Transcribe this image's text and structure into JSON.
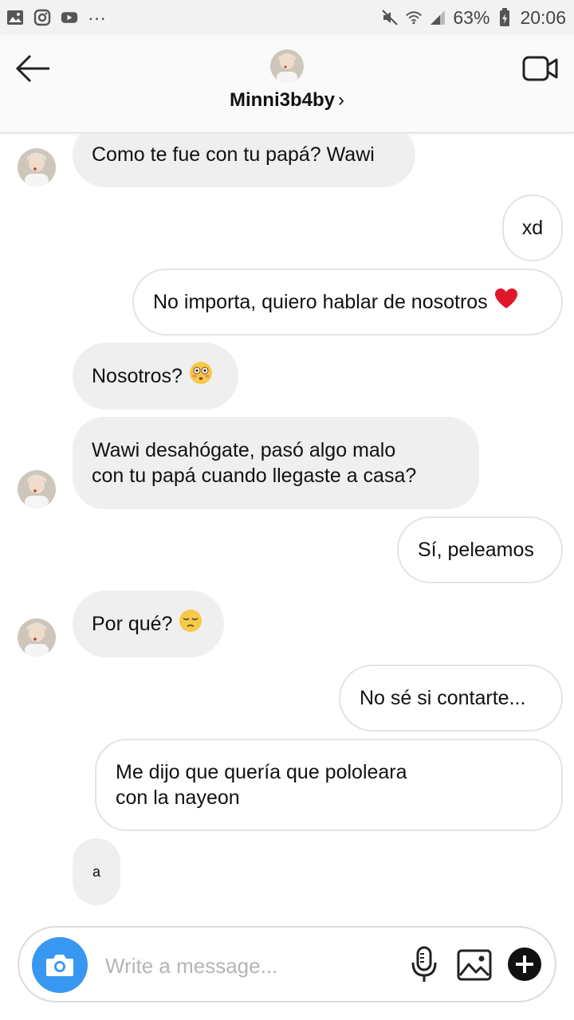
{
  "status_bar": {
    "battery": "63%",
    "time": "20:06",
    "dots": "···"
  },
  "header": {
    "username": "Minni3b4by",
    "chevron": "›"
  },
  "messages": [
    {
      "side": "in",
      "text": "Como te fue con tu papá? Wawi",
      "avatar": true
    },
    {
      "side": "out",
      "text": "xd"
    },
    {
      "side": "out",
      "text": "No importa, quiero hablar de nosotros",
      "emoji": "heart"
    },
    {
      "side": "in",
      "text": "Nosotros?",
      "emoji": "flushed-face"
    },
    {
      "side": "in",
      "line1": "Wawi desahógate, pasó algo malo",
      "line2": "con tu papá cuando llegaste a casa?",
      "avatar": true
    },
    {
      "side": "out",
      "text": "Sí, peleamos"
    },
    {
      "side": "in",
      "text": "Por qué?",
      "emoji": "pensive-face",
      "avatar": true
    },
    {
      "side": "out",
      "text": "No sé si contarte..."
    },
    {
      "side": "out",
      "line1": "Me dijo que quería que pololeara",
      "line2": "con la nayeon"
    },
    {
      "side": "in",
      "text": "a"
    }
  ],
  "composer": {
    "placeholder": "Write a message..."
  },
  "icons": {
    "back": "arrow-left-icon",
    "video": "video-call-icon",
    "camera": "camera-icon",
    "mic": "microphone-icon",
    "gallery": "gallery-icon",
    "plus": "plus-icon"
  },
  "colors": {
    "accent": "#3897f0",
    "incoming_bubble": "#efefef",
    "outgoing_border": "#e3e3e3",
    "heart": "#e0162b"
  }
}
